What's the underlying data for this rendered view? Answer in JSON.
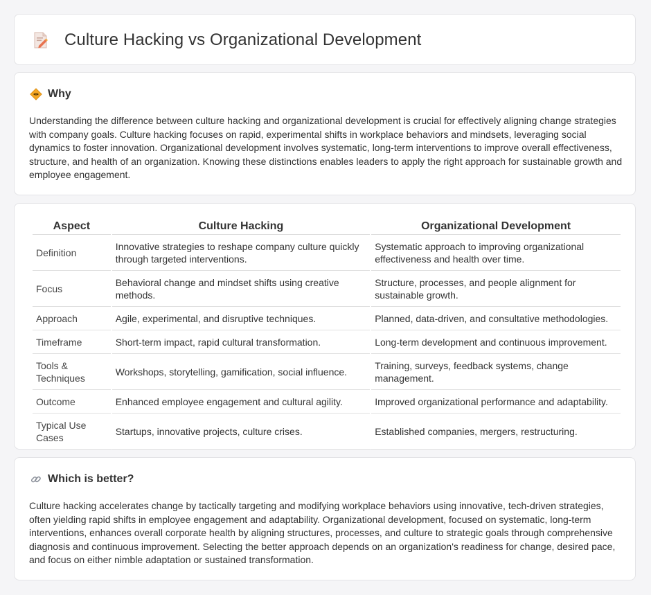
{
  "header": {
    "title": "Culture Hacking vs Organizational Development",
    "icon": "document-pencil-icon"
  },
  "why": {
    "title": "Why",
    "icon": "diamond-sign-icon",
    "text": "Understanding the difference between culture hacking and organizational development is crucial for effectively aligning change strategies with company goals. Culture hacking focuses on rapid, experimental shifts in workplace behaviors and mindsets, leveraging social dynamics to foster innovation. Organizational development involves systematic, long-term interventions to improve overall effectiveness, structure, and health of an organization. Knowing these distinctions enables leaders to apply the right approach for sustainable growth and employee engagement."
  },
  "comparison": {
    "headers": [
      "Aspect",
      "Culture Hacking",
      "Organizational Development"
    ],
    "rows": [
      [
        "Definition",
        "Innovative strategies to reshape company culture quickly through targeted interventions.",
        "Systematic approach to improving organizational effectiveness and health over time."
      ],
      [
        "Focus",
        "Behavioral change and mindset shifts using creative methods.",
        "Structure, processes, and people alignment for sustainable growth."
      ],
      [
        "Approach",
        "Agile, experimental, and disruptive techniques.",
        "Planned, data-driven, and consultative methodologies."
      ],
      [
        "Timeframe",
        "Short-term impact, rapid cultural transformation.",
        "Long-term development and continuous improvement."
      ],
      [
        "Tools & Techniques",
        "Workshops, storytelling, gamification, social influence.",
        "Training, surveys, feedback systems, change management."
      ],
      [
        "Outcome",
        "Enhanced employee engagement and cultural agility.",
        "Improved organizational performance and adaptability."
      ],
      [
        "Typical Use Cases",
        "Startups, innovative projects, culture crises.",
        "Established companies, mergers, restructuring."
      ]
    ]
  },
  "better": {
    "title": "Which is better?",
    "icon": "link-icon",
    "text": "Culture hacking accelerates change by tactically targeting and modifying workplace behaviors using innovative, tech-driven strategies, often yielding rapid shifts in employee engagement and adaptability. Organizational development, focused on systematic, long-term interventions, enhances overall corporate health by aligning structures, processes, and culture to strategic goals through comprehensive diagnosis and continuous improvement. Selecting the better approach depends on an organization's readiness for change, desired pace, and focus on either nimble adaptation or sustained transformation."
  },
  "colors": {
    "background": "#f5f5f7",
    "card": "#ffffff",
    "text": "#333333",
    "border": "#e3e3e6"
  }
}
